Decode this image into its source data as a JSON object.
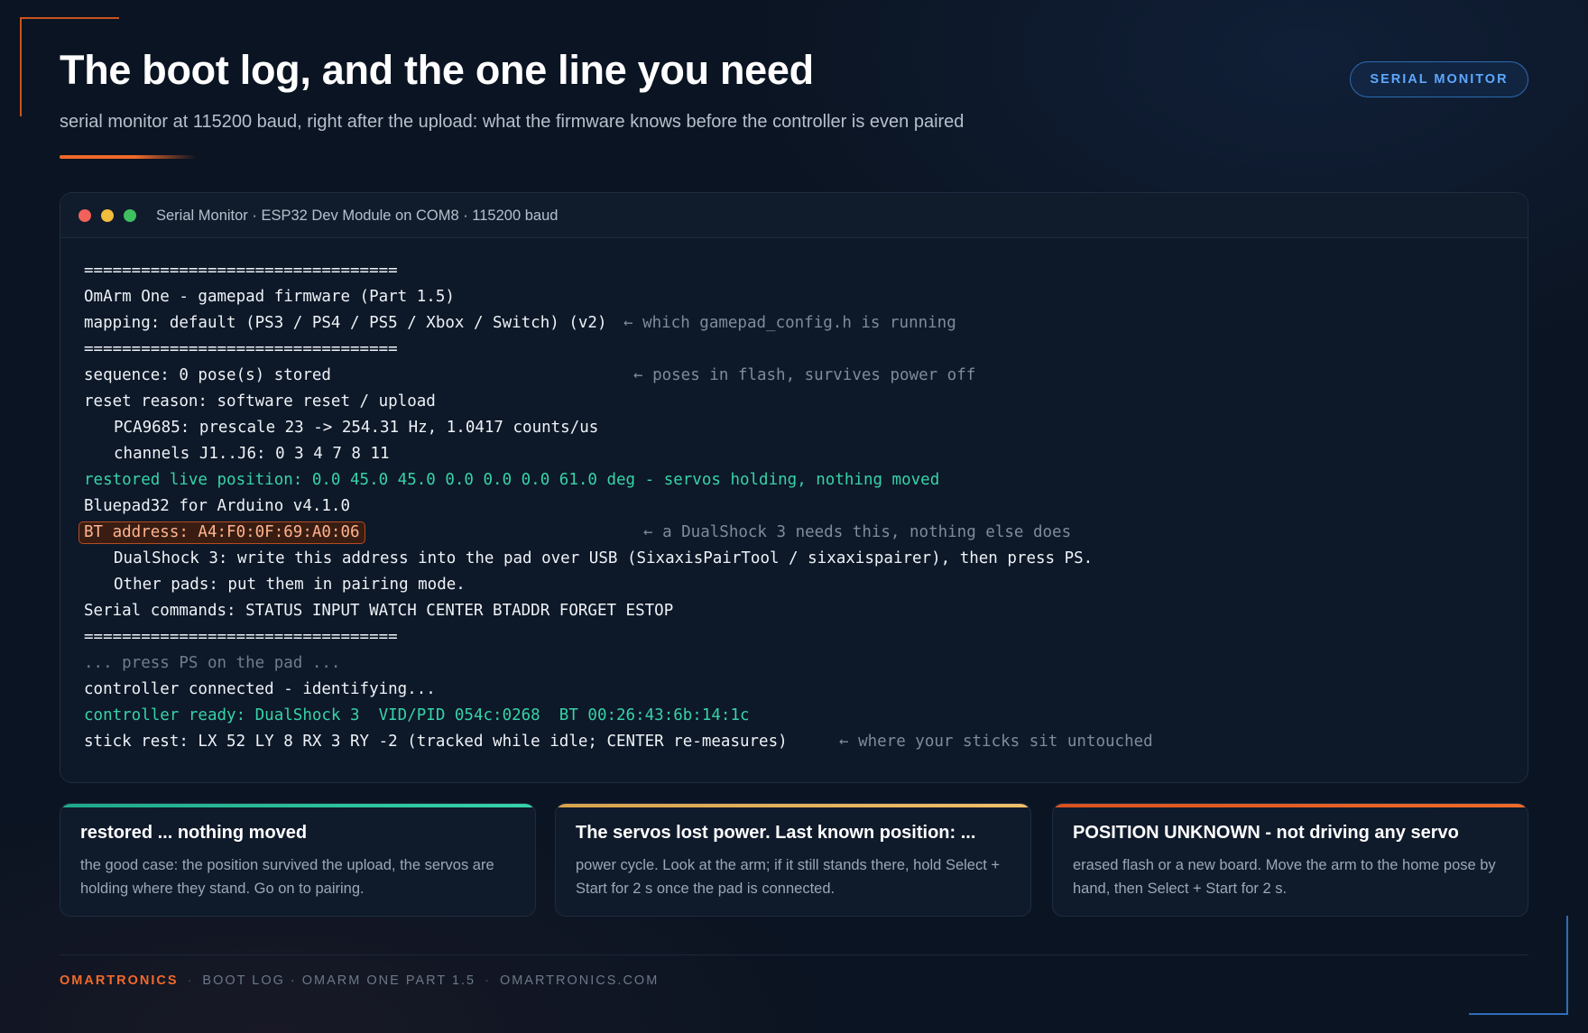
{
  "header": {
    "title": "The boot log, and the one line you need",
    "subtitle": "serial monitor at 115200 baud, right after the upload: what the firmware knows before the controller is even paired",
    "badge": "SERIAL MONITOR"
  },
  "terminal": {
    "title": "Serial Monitor · ESP32 Dev Module on COM8 · 115200 baud",
    "lines": {
      "sep1": "=================================",
      "firmware": "OmArm One - gamepad firmware (Part 1.5)",
      "mapping": "mapping: default (PS3 / PS4 / PS5 / Xbox / Switch) (v2)",
      "mapping_note": "← which gamepad_config.h is running",
      "sep2": "=================================",
      "sequence": "sequence: 0 pose(s) stored",
      "sequence_note": "← poses in flash, survives power off",
      "reset": "reset reason: software reset / upload",
      "pca": "PCA9685: prescale 23 -> 254.31 Hz, 1.0417 counts/us",
      "channels": "channels J1..J6: 0 3 4 7 8 11",
      "restored": "restored live position: 0.0 45.0 45.0 0.0 0.0 0.0 61.0 deg - servos holding, nothing moved",
      "bluepad": "Bluepad32 for Arduino v4.1.0",
      "bt_address": "BT address: A4:F0:0F:69:A0:06",
      "bt_note": "← a DualShock 3 needs this, nothing else does",
      "ds3": "DualShock 3: write this address into the pad over USB (SixaxisPairTool / sixaxispairer), then press PS.",
      "other": "Other pads: put them in pairing mode.",
      "serial_cmds": "Serial commands: STATUS INPUT WATCH CENTER BTADDR FORGET ESTOP",
      "sep3": "=================================",
      "press_ps": "... press PS on the pad ...",
      "connected": "controller connected - identifying...",
      "ready": "controller ready: DualShock 3  VID/PID 054c:0268  BT 00:26:43:6b:14:1c",
      "stick": "stick rest: LX 52 LY 8 RX 3 RY -2 (tracked while idle; CENTER re-measures)",
      "stick_note": "← where your sticks sit untouched"
    }
  },
  "cards": [
    {
      "title": "restored ... nothing moved",
      "body": "the good case: the position survived the upload, the servos are holding where they stand. Go on to pairing.",
      "accent": "#2fc3a0"
    },
    {
      "title": "The servos lost power. Last known position: ...",
      "body": "power cycle. Look at the arm; if it still stands there, hold Select + Start for 2 s once the pad is connected.",
      "accent": "#e6b15a"
    },
    {
      "title": "POSITION UNKNOWN - not driving any servo",
      "body": "erased flash or a new board. Move the arm to the home pose by hand, then Select + Start for 2 s.",
      "accent": "#e8612c"
    }
  ],
  "footer": {
    "brand": "OMARTRONICS",
    "section": "BOOT LOG · OMARM ONE PART 1.5",
    "site": "OMARTRONICS.COM"
  },
  "colors": {
    "background": "#0b1422",
    "accent_orange": "#f06a2a",
    "accent_blue": "#5ea8ff",
    "log_green": "#37d3a8"
  }
}
